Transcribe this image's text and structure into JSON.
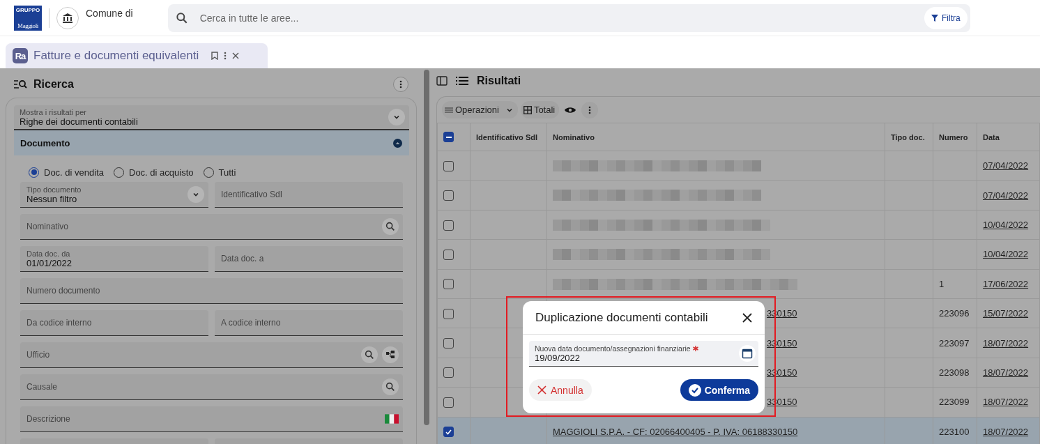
{
  "header": {
    "logo": {
      "top": "GRUPPO",
      "name": "Maggioli"
    },
    "entity": "Comune di",
    "search": {
      "placeholder": "Cerca in tutte le aree..."
    },
    "filter_button": "Filtra"
  },
  "tabs": [
    {
      "badge": "Ra",
      "label": "Fatture e documenti equivalenti",
      "selected": true
    }
  ],
  "search_panel": {
    "title": "Ricerca",
    "show_results": {
      "label": "Mostra i risultati per",
      "value": "Righe dei documenti contabili"
    },
    "section": {
      "title": "Documento",
      "expanded": true
    },
    "radios": [
      {
        "label": "Doc. di vendita",
        "selected": true
      },
      {
        "label": "Doc. di acquisto",
        "selected": false
      },
      {
        "label": "Tutti",
        "selected": false
      }
    ],
    "fields": [
      {
        "kind": "select",
        "label": "Tipo documento",
        "value": "Nessun filtro",
        "wide": false
      },
      {
        "kind": "plain",
        "label": "Identificativo SdI",
        "wide": false
      },
      {
        "kind": "lookup",
        "label": "Nominativo",
        "wide": true
      },
      {
        "kind": "plain",
        "label": "Data doc. da",
        "value": "01/01/2022",
        "wide": false
      },
      {
        "kind": "plain",
        "label": "Data doc. a",
        "wide": false
      },
      {
        "kind": "plain",
        "label": "Numero documento",
        "wide": true
      },
      {
        "kind": "plain",
        "label": "Da codice interno",
        "wide": false
      },
      {
        "kind": "plain",
        "label": "A codice interno",
        "wide": false
      },
      {
        "kind": "office",
        "label": "Ufficio",
        "wide": true
      },
      {
        "kind": "lookup",
        "label": "Causale",
        "wide": true
      },
      {
        "kind": "language",
        "label": "Descrizione",
        "wide": true
      },
      {
        "kind": "plain",
        "wide": false
      },
      {
        "kind": "plain",
        "wide": false
      }
    ]
  },
  "results_panel": {
    "title": "Risultati",
    "toolbar": [
      "Operazioni",
      "Totali"
    ],
    "table": {
      "select_all": {
        "indeterminate": true
      },
      "columns": [
        "Identificativo SdI",
        "Nominativo",
        "Tipo doc.",
        "Numero",
        "Data"
      ],
      "rows": [
        {
          "checked": false,
          "redacted": true,
          "data": "07/04/2022"
        },
        {
          "checked": false,
          "redacted": true,
          "data": "07/04/2022"
        },
        {
          "checked": false,
          "redacted": true,
          "data": "10/04/2022"
        },
        {
          "checked": false,
          "redacted": true,
          "data": "10/04/2022"
        },
        {
          "checked": false,
          "redacted": true,
          "numero": "1",
          "data": "17/06/2022"
        },
        {
          "checked": false,
          "redacted": false,
          "covered": true,
          "nominativo": "330150",
          "numero": "223096",
          "data": "15/07/2022"
        },
        {
          "checked": false,
          "redacted": false,
          "covered": true,
          "nominativo": "330150",
          "numero": "223097",
          "data": "18/07/2022"
        },
        {
          "checked": false,
          "redacted": false,
          "covered": true,
          "nominativo": "330150",
          "numero": "223098",
          "data": "18/07/2022"
        },
        {
          "checked": false,
          "redacted": false,
          "covered": true,
          "nominativo": "330150",
          "numero": "223099",
          "data": "18/07/2022"
        },
        {
          "checked": true,
          "redacted": false,
          "covered": false,
          "nominativo": "MAGGIOLI S.P.A. - CF: 02066400405 - P. IVA: 06188330150",
          "numero": "223100",
          "data": "18/07/2022"
        }
      ]
    }
  },
  "dialog": {
    "title": "Duplicazione documenti contabili",
    "field": {
      "label": "Nuova data documento/assegnazioni finanziarie",
      "required": true,
      "value": "19/09/2022"
    },
    "cancel": "Annulla",
    "confirm": "Conferma"
  }
}
